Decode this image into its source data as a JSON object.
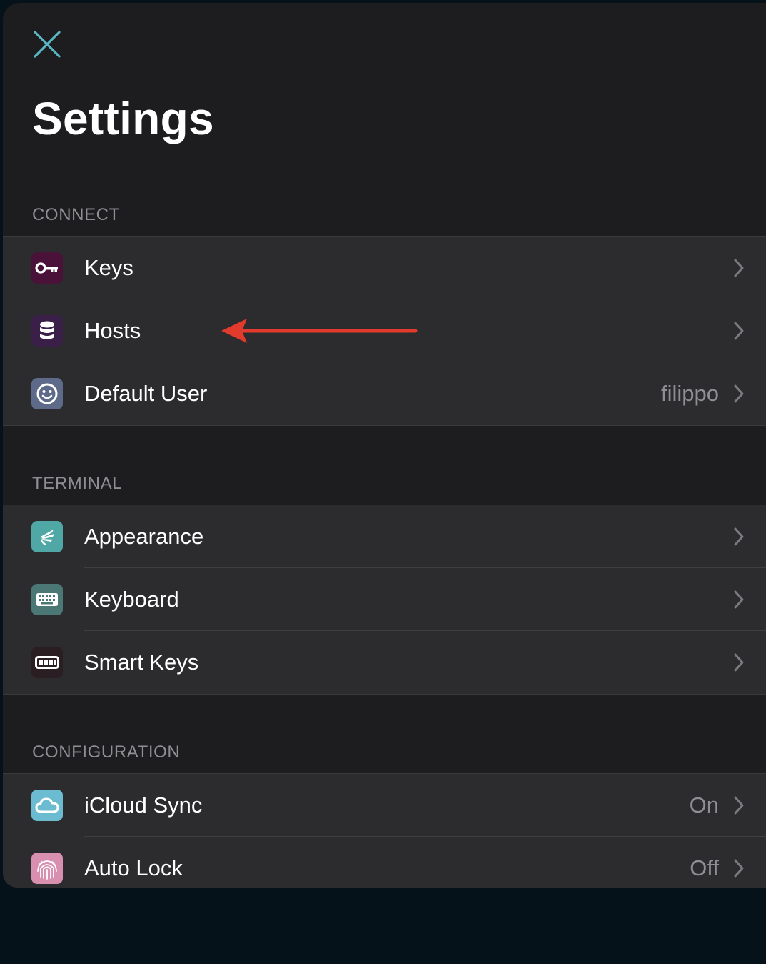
{
  "screen": {
    "title": "Settings",
    "close_icon": "close-icon",
    "accent_color": "#5ab7c4"
  },
  "sections": [
    {
      "header": "CONNECT",
      "rows": [
        {
          "label": "Keys",
          "value": "",
          "icon": "key-icon",
          "icon_color": "#4a1238"
        },
        {
          "label": "Hosts",
          "value": "",
          "icon": "database-icon",
          "icon_color": "#3a1f48"
        },
        {
          "label": "Default User",
          "value": "filippo",
          "icon": "smiley-icon",
          "icon_color": "#5d6a8a"
        }
      ]
    },
    {
      "header": "TERMINAL",
      "rows": [
        {
          "label": "Appearance",
          "value": "",
          "icon": "palette-icon",
          "icon_color": "#4fa8a6"
        },
        {
          "label": "Keyboard",
          "value": "",
          "icon": "keyboard-icon",
          "icon_color": "#4b7775"
        },
        {
          "label": "Smart Keys",
          "value": "",
          "icon": "smart-keys-icon",
          "icon_color": "#2a1e22"
        }
      ]
    },
    {
      "header": "CONFIGURATION",
      "rows": [
        {
          "label": "iCloud Sync",
          "value": "On",
          "icon": "cloud-icon",
          "icon_color": "#6bbcd0"
        },
        {
          "label": "Auto Lock",
          "value": "Off",
          "icon": "fingerprint-icon",
          "icon_color": "#d88fb0"
        }
      ]
    }
  ],
  "annotation": {
    "arrow_color": "#e23a2c",
    "icon": "red-arrow-icon"
  }
}
